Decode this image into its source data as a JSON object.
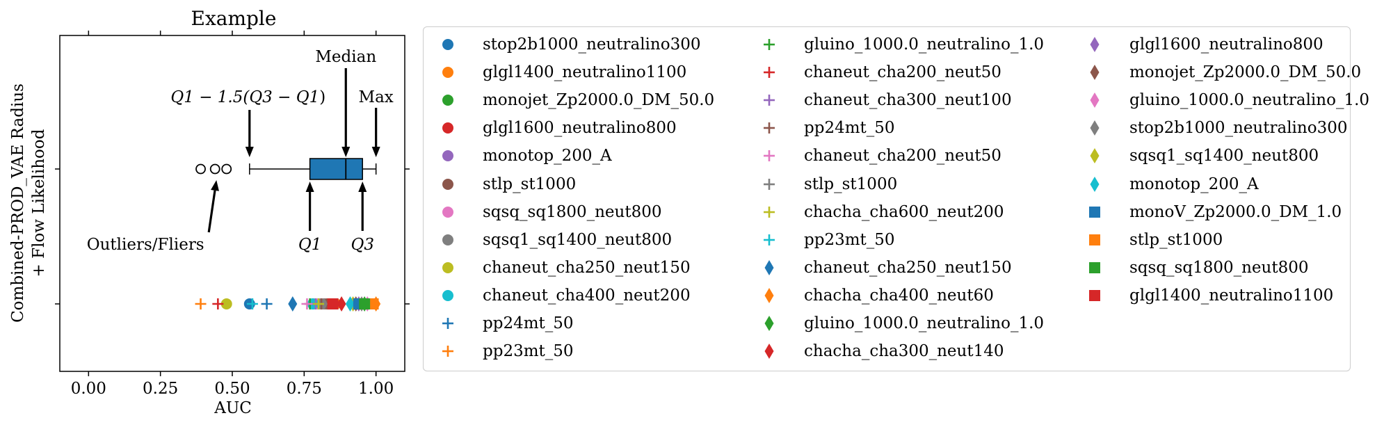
{
  "chart_data": {
    "type": "scatter",
    "title": "Example",
    "xlabel": "AUC",
    "ylabel_lines": [
      "Combined-PROD_VAE Radius",
      "+ Flow Likelihood"
    ],
    "xlim": [
      -0.1,
      1.1
    ],
    "xticks": [
      "0.00",
      "0.25",
      "0.50",
      "0.75",
      "1.00"
    ],
    "xtick_values": [
      0.0,
      0.25,
      0.5,
      0.75,
      1.0
    ],
    "boxplot": {
      "whisker_low": 0.56,
      "q1": 0.77,
      "median": 0.895,
      "q3": 0.953,
      "whisker_high": 1.0,
      "fill": "#1f77b4",
      "outliers": [
        0.39,
        0.44,
        0.48
      ]
    },
    "annotations": [
      {
        "text": "Median",
        "x": 0.895,
        "row": "box"
      },
      {
        "text": "Max",
        "x": 1.0,
        "row": "box"
      },
      {
        "text": "Outliers/Fliers",
        "x": 0.44,
        "row": "box"
      },
      {
        "text": "Q1",
        "x": 0.77,
        "row": "box"
      },
      {
        "text": "Q3",
        "x": 0.953,
        "row": "box"
      }
    ],
    "annotation_formula": {
      "a": "Q1 − 1.5(",
      "b": "Q3 − Q1",
      "c": ")",
      "x": 0.56
    },
    "series": [
      {
        "name": "stop2b1000_neutralino300",
        "marker": "circle",
        "color": "#1f77b4",
        "x": 0.56
      },
      {
        "name": "glgl1400_neutralino1100",
        "marker": "circle",
        "color": "#ff7f0e",
        "x": 0.86
      },
      {
        "name": "monojet_Zp2000.0_DM_50.0",
        "marker": "circle",
        "color": "#2ca02c",
        "x": 0.78
      },
      {
        "name": "glgl1600_neutralino800",
        "marker": "circle",
        "color": "#d62728",
        "x": 0.82
      },
      {
        "name": "monotop_200_A",
        "marker": "circle",
        "color": "#9467bd",
        "x": 0.8
      },
      {
        "name": "stlp_st1000",
        "marker": "circle",
        "color": "#8c564b",
        "x": 0.83
      },
      {
        "name": "sqsq_sq1800_neut800",
        "marker": "circle",
        "color": "#e377c2",
        "x": 0.79
      },
      {
        "name": "sqsq1_sq1400_neut800",
        "marker": "circle",
        "color": "#7f7f7f",
        "x": 0.81
      },
      {
        "name": "chaneut_cha250_neut150",
        "marker": "circle",
        "color": "#bcbd22",
        "x": 0.48
      },
      {
        "name": "chaneut_cha400_neut200",
        "marker": "circle",
        "color": "#17becf",
        "x": 0.78
      },
      {
        "name": "pp24mt_50",
        "marker": "plus",
        "color": "#1f77b4",
        "x": 0.62
      },
      {
        "name": "pp23mt_50",
        "marker": "plus",
        "color": "#ff7f0e",
        "x": 0.39
      },
      {
        "name": "gluino_1000.0_neutralino_1.0",
        "marker": "plus",
        "color": "#2ca02c",
        "x": 0.77
      },
      {
        "name": "chaneut_cha200_neut50",
        "marker": "plus",
        "color": "#d62728",
        "x": 0.45
      },
      {
        "name": "chaneut_cha300_neut100",
        "marker": "plus",
        "color": "#9467bd",
        "x": 0.79
      },
      {
        "name": "pp24mt_50",
        "marker": "plus",
        "color": "#8c564b",
        "x": 0.81
      },
      {
        "name": "chaneut_cha200_neut50",
        "marker": "plus",
        "color": "#e377c2",
        "x": 0.76
      },
      {
        "name": "stlp_st1000",
        "marker": "plus",
        "color": "#7f7f7f",
        "x": 0.82
      },
      {
        "name": "chacha_cha600_neut200",
        "marker": "plus",
        "color": "#bcbd22",
        "x": 0.8
      },
      {
        "name": "pp23mt_50",
        "marker": "plus",
        "color": "#17becf",
        "x": 0.57
      },
      {
        "name": "chaneut_cha250_neut150",
        "marker": "diamond",
        "color": "#1f77b4",
        "x": 0.71
      },
      {
        "name": "chacha_cha400_neut60",
        "marker": "diamond",
        "color": "#ff7f0e",
        "x": 1.0
      },
      {
        "name": "gluino_1000.0_neutralino_1.0",
        "marker": "diamond",
        "color": "#2ca02c",
        "x": 0.96
      },
      {
        "name": "chacha_cha300_neut140",
        "marker": "diamond",
        "color": "#d62728",
        "x": 0.88
      },
      {
        "name": "glgl1600_neutralino800",
        "marker": "diamond",
        "color": "#9467bd",
        "x": 0.94
      },
      {
        "name": "monojet_Zp2000.0_DM_50.0",
        "marker": "diamond",
        "color": "#8c564b",
        "x": 0.93
      },
      {
        "name": "gluino_1000.0_neutralino_1.0",
        "marker": "diamond",
        "color": "#e377c2",
        "x": 0.97
      },
      {
        "name": "stop2b1000_neutralino300",
        "marker": "diamond",
        "color": "#7f7f7f",
        "x": 0.95
      },
      {
        "name": "sqsq1_sq1400_neut800",
        "marker": "diamond",
        "color": "#bcbd22",
        "x": 0.92
      },
      {
        "name": "monotop_200_A",
        "marker": "diamond",
        "color": "#17becf",
        "x": 0.91
      },
      {
        "name": "monoV_Zp2000.0_DM_1.0",
        "marker": "square",
        "color": "#1f77b4",
        "x": 0.94
      },
      {
        "name": "stlp_st1000",
        "marker": "square",
        "color": "#ff7f0e",
        "x": 0.99
      },
      {
        "name": "sqsq_sq1800_neut800",
        "marker": "square",
        "color": "#2ca02c",
        "x": 0.96
      },
      {
        "name": "glgl1400_neutralino1100",
        "marker": "square",
        "color": "#d62728",
        "x": 0.85
      }
    ],
    "grid": false,
    "legend_placement": "right of plot, 3 columns"
  }
}
